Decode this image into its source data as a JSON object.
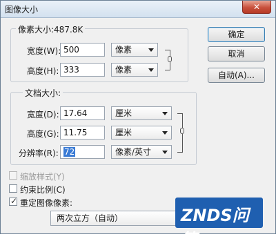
{
  "window": {
    "title": "图像大小",
    "close_icon": "close-icon"
  },
  "pixel_dimensions": {
    "legend": "像素大小:487.8K",
    "width_label": "宽度(W):",
    "width_value": "500",
    "width_unit": "像素",
    "height_label": "高度(H):",
    "height_value": "333",
    "height_unit": "像素"
  },
  "document_size": {
    "legend": "文档大小:",
    "width_label": "宽度(D):",
    "width_value": "17.64",
    "width_unit": "厘米",
    "height_label": "高度(G):",
    "height_value": "11.75",
    "height_unit": "厘米",
    "resolution_label": "分辨率(R):",
    "resolution_value": "72",
    "resolution_unit": "像素/英寸"
  },
  "buttons": {
    "ok": "确定",
    "cancel": "取消",
    "auto": "自动(A)..."
  },
  "options": {
    "scale_styles": {
      "label": "缩放样式(Y)",
      "checked": false,
      "enabled": false
    },
    "constrain_proportions": {
      "label": "约束比例(C)",
      "checked": false,
      "enabled": true
    },
    "resample_image": {
      "label": "重定图像像素:",
      "checked": true,
      "enabled": true
    },
    "resample_method": "两次立方（自动）"
  },
  "watermark": {
    "text": "ZNDS问答",
    "color": "#1f5fb0"
  }
}
